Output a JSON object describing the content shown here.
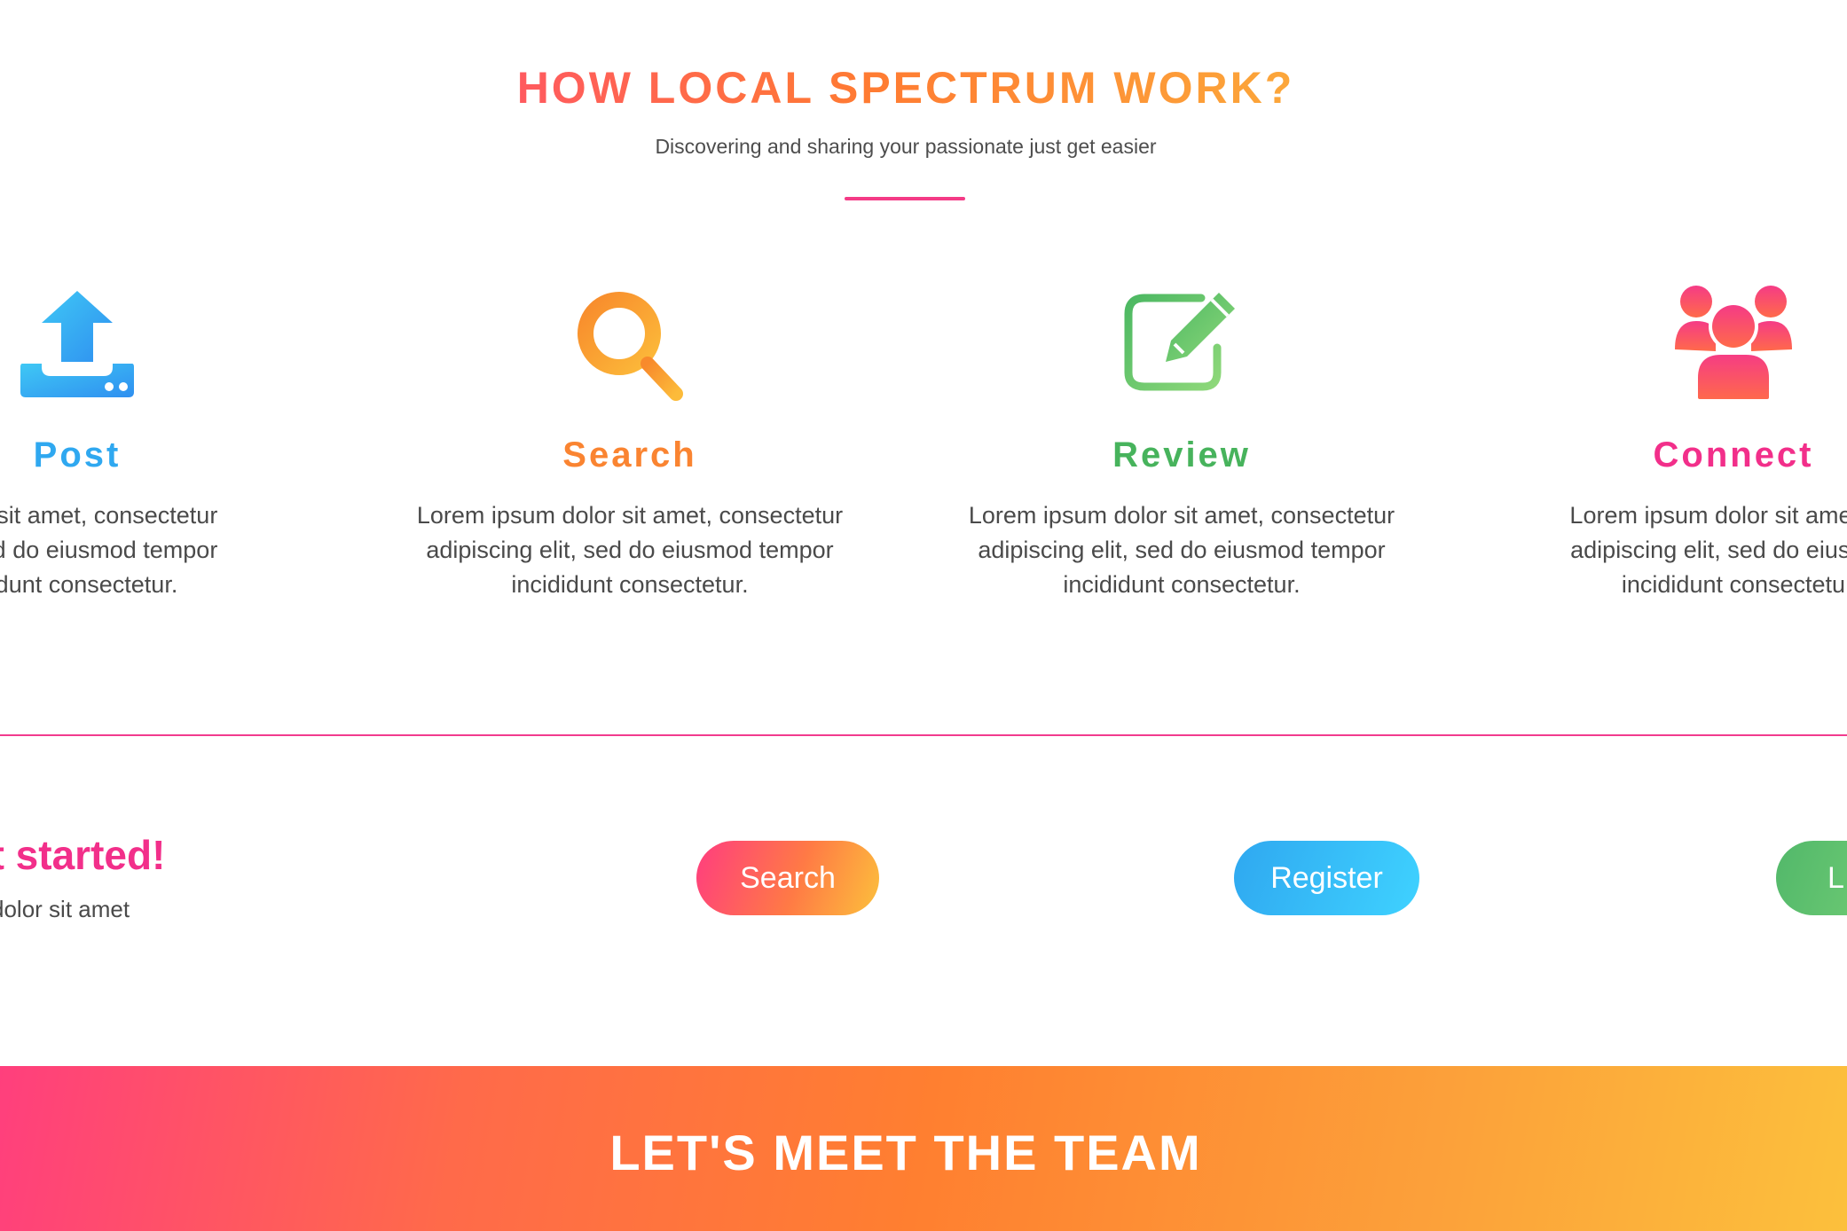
{
  "section": {
    "title": "HOW LOCAL SPECTRUM WORK?",
    "subtitle": "Discovering and sharing your passionate just get easier"
  },
  "features": [
    {
      "title": "Post",
      "icon": "upload-icon",
      "color": "#2fa8f0",
      "line1": "dolor sit amet, consectetur",
      "line2": "lit, sed do eiusmod tempor",
      "line3": "didunt consectetur."
    },
    {
      "title": "Search",
      "icon": "search-icon",
      "color": "#fa8431",
      "line1": "Lorem ipsum dolor sit amet, consectetur",
      "line2": "adipiscing elit, sed do eiusmod tempor",
      "line3": "incididunt consectetur."
    },
    {
      "title": "Review",
      "icon": "edit-icon",
      "color": "#47b35c",
      "line1": "Lorem ipsum dolor sit amet, consectetur",
      "line2": "adipiscing elit, sed do eiusmod tempor",
      "line3": "incididunt consectetur."
    },
    {
      "title": "Connect",
      "icon": "users-icon",
      "color": "#f22f8a",
      "line1": "Lorem ipsum dolor sit amet, co",
      "line2": "adipiscing elit, sed do eiusmod",
      "line3": "incididunt consectetu"
    }
  ],
  "get_started": {
    "title": "et started!",
    "subtitle": "dolor sit amet",
    "buttons": {
      "search": "Search",
      "register": "Register",
      "login": "L"
    }
  },
  "team": {
    "title": "LET'S MEET THE TEAM"
  },
  "colors": {
    "accent_pink": "#f22f8a",
    "accent_orange": "#fa8431",
    "accent_blue": "#2fa8f0",
    "accent_green": "#47b35c"
  }
}
